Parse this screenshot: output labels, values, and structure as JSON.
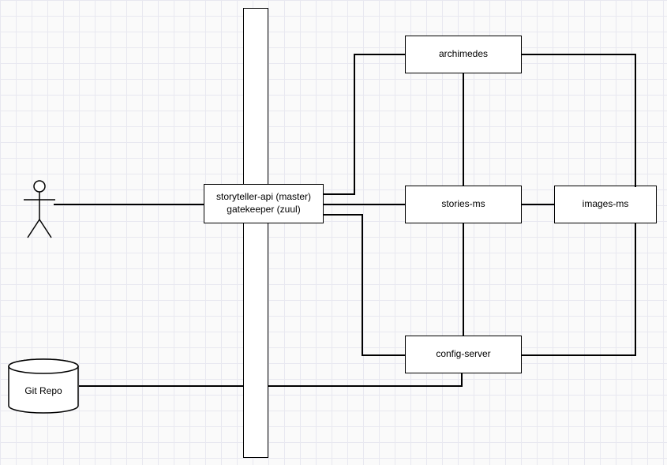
{
  "nodes": {
    "gateway_line1": "storyteller-api (master)",
    "gateway_line2": "gatekeeper (zuul)",
    "archimedes": "archimedes",
    "stories_ms": "stories-ms",
    "images_ms": "images-ms",
    "config_server": "config-server",
    "git_repo": "Git Repo"
  },
  "chart_data": {
    "type": "diagram",
    "title": "",
    "nodes": [
      {
        "id": "actor",
        "type": "actor",
        "label": ""
      },
      {
        "id": "git_repo",
        "type": "database",
        "label": "Git Repo"
      },
      {
        "id": "gateway",
        "type": "service",
        "label": "storyteller-api (master) gatekeeper (zuul)"
      },
      {
        "id": "bus",
        "type": "bus",
        "label": ""
      },
      {
        "id": "archimedes",
        "type": "service",
        "label": "archimedes"
      },
      {
        "id": "stories_ms",
        "type": "service",
        "label": "stories-ms"
      },
      {
        "id": "images_ms",
        "type": "service",
        "label": "images-ms"
      },
      {
        "id": "config_server",
        "type": "service",
        "label": "config-server"
      }
    ],
    "edges": [
      {
        "from": "actor",
        "to": "gateway"
      },
      {
        "from": "gateway",
        "to": "bus"
      },
      {
        "from": "bus",
        "to": "archimedes"
      },
      {
        "from": "bus",
        "to": "stories_ms"
      },
      {
        "from": "bus",
        "to": "config_server"
      },
      {
        "from": "archimedes",
        "to": "stories_ms"
      },
      {
        "from": "stories_ms",
        "to": "config_server"
      },
      {
        "from": "stories_ms",
        "to": "images_ms"
      },
      {
        "from": "archimedes",
        "to": "images_ms"
      },
      {
        "from": "config_server",
        "to": "images_ms"
      },
      {
        "from": "git_repo",
        "to": "config_server"
      }
    ]
  }
}
